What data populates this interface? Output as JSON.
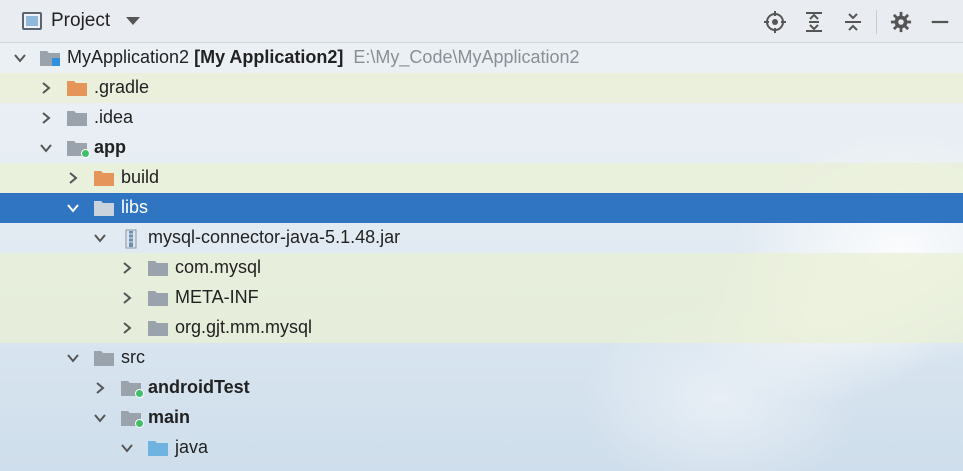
{
  "toolbar": {
    "view_label": "Project",
    "icons": [
      "locate-icon",
      "expand-all-icon",
      "collapse-all-icon",
      "settings-icon",
      "hide-icon"
    ]
  },
  "colors": {
    "folder_gray": "#9aa3ac",
    "folder_orange": "#e6955a",
    "folder_blue": "#6fb3e0",
    "selection": "#2f75c2",
    "module_dot": "#3fbf6a",
    "path_gray": "#8a8f96"
  },
  "tree": [
    {
      "name": "MyApplication2",
      "module_name": "[My Application2]",
      "path": "E:\\My_Code\\MyApplication2",
      "expanded": true,
      "icon": "module-folder-icon"
    },
    {
      "name": ".gradle",
      "expanded": false,
      "icon": "orange-folder-icon"
    },
    {
      "name": ".idea",
      "expanded": false,
      "icon": "folder-icon"
    },
    {
      "name": "app",
      "expanded": true,
      "icon": "module-folder-icon"
    },
    {
      "name": "build",
      "expanded": false,
      "icon": "orange-folder-icon"
    },
    {
      "name": "libs",
      "expanded": true,
      "selected": true,
      "icon": "folder-icon"
    },
    {
      "name": "mysql-connector-java-5.1.48.jar",
      "expanded": true,
      "icon": "jar-icon"
    },
    {
      "name": "com.mysql",
      "expanded": false,
      "icon": "package-folder-icon"
    },
    {
      "name": "META-INF",
      "expanded": false,
      "icon": "package-folder-icon"
    },
    {
      "name": "org.gjt.mm.mysql",
      "expanded": false,
      "icon": "package-folder-icon"
    },
    {
      "name": "src",
      "expanded": true,
      "icon": "folder-icon"
    },
    {
      "name": "androidTest",
      "expanded": false,
      "icon": "source-root-icon"
    },
    {
      "name": "main",
      "expanded": true,
      "icon": "source-root-icon"
    },
    {
      "name": "java",
      "expanded": true,
      "icon": "blue-folder-icon"
    }
  ]
}
